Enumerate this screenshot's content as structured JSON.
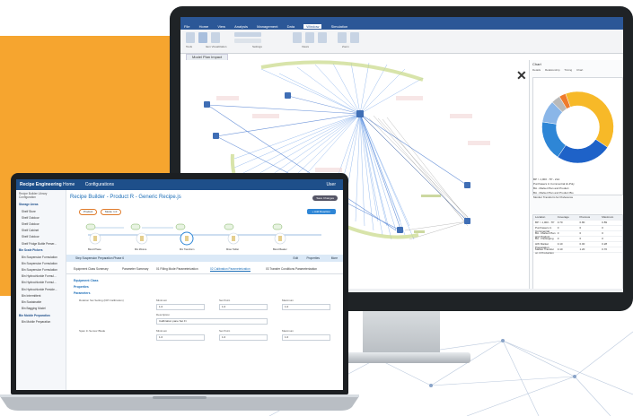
{
  "desktop_app": {
    "ribbon_tabs": [
      "File",
      "Home",
      "View",
      "Analysis",
      "Management",
      "Data",
      "Window",
      "Simulation"
    ],
    "active_tab": "Window",
    "ribbon_labels": [
      "Tools",
      "Item Visualization",
      "Settings",
      "Views",
      "Zoom"
    ],
    "document_tab": "Model Plan Impact",
    "right_panel": {
      "title": "Chart",
      "tabs": [
        "Details",
        "Relationship",
        "Timing",
        "Chart"
      ],
      "legend": [
        "BP > 1,000 - TP - 21A",
        "Purchasers in Commercial Hi-Poly",
        "BA - Market Plan and Product",
        "BA - Market Plan and Product Bio",
        "Monitor Transform for Preference",
        "Pool - Capture Prep"
      ],
      "table_headers": [
        "Location",
        "Coverage",
        "Previous",
        "Maximum"
      ],
      "table_rows": [
        [
          "BP > 1,000 - TP",
          "0.70",
          "0.80",
          "0.89"
        ],
        [
          "Purchasers in Commercial",
          "0",
          "0",
          "0"
        ],
        [
          "BA - Market Plan and Product",
          "0",
          "0",
          "0"
        ],
        [
          "BA - Packaging",
          "0",
          "0",
          "0"
        ],
        [
          "HW Market Preparation",
          "0.10",
          "0.00",
          "0.28"
        ],
        [
          "Market Transfer on it Production",
          "0.10",
          "1.20",
          "0.70"
        ]
      ]
    },
    "donut": [
      {
        "value": 40,
        "color": "#f7b928"
      },
      {
        "value": 25,
        "color": "#1e62c8"
      },
      {
        "value": 18,
        "color": "#2e86d6"
      },
      {
        "value": 10,
        "color": "#8ab6e8"
      },
      {
        "value": 4,
        "color": "#b9b9b9"
      },
      {
        "value": 3,
        "color": "#ef7b2c"
      }
    ]
  },
  "laptop_app": {
    "logo": "Recipe Engineering",
    "nav": [
      "Home",
      "Configurations"
    ],
    "user": "User",
    "sidebar_header": "Recipe Builder Library Configuration",
    "sidebar_groups": [
      {
        "title": "Storage Areas",
        "items": [
          "Shelf Store",
          "Shelf Outdoor",
          "Shelf Outdoor",
          "Shelf Cabinet",
          "Shelf Outdoor",
          "Shelf Fridge Bottle Preser..."
        ]
      },
      {
        "title": "Bin Scale Pickers",
        "items": [
          "Bin Suspension Formulation",
          "Bin Suspension Formulation",
          "Bin Suspension Formulation",
          "Bin Hydrochloride Formul...",
          "Bin Hydrochloride Formul...",
          "Bin Hydrochloride Preside...",
          "Bin Intermittent",
          "Bin Sustainable",
          "Bin Bagging Model"
        ]
      },
      {
        "title": "Bin Mobile Preparation",
        "items": [
          "Bin Mobile Preparation"
        ]
      }
    ],
    "page_title": "Recipe Builder - Product R - Generic Recipe.js",
    "save_label": "Save Changes",
    "pills": [
      "Product",
      "Mode: 1.0"
    ],
    "add_button": "+ Add Reaction",
    "flow_nodes": [
      "Bin Mix",
      "Bin Mix",
      "Bin",
      "Bin",
      "Bin"
    ],
    "flow_labels": [
      "Blend Phase",
      "Mix Mixture",
      "Mix Transform",
      "Mixer Tablet",
      "Blend Beaker"
    ],
    "step_bar": "Step Suspension Preparation Phase 6",
    "step_bar_actions": [
      "Edit",
      "Properties",
      "More"
    ],
    "tabs": [
      "Equipment Class Summary",
      "Parameter Summary",
      "01 Filling Mode Parameterization",
      "02 Calibration Parameterization",
      "03 Transfer Conditions Parameterization"
    ],
    "active_tab_index": 3,
    "sections": [
      "Equipment Class",
      "Properties",
      "Parameters"
    ],
    "form": {
      "row1_label": "Rotation Set Setting (DPI Calibration)",
      "col_headers": [
        "Minimum",
        "Set Point",
        "Maximum"
      ],
      "row1_values": [
        "1.0",
        "1.0",
        "1.0"
      ],
      "description_label": "Description",
      "description_value": "Calibration pane Set Fi",
      "row2_label": "Span In Sensor Blade",
      "row2_values": [
        "1.0",
        "1.0",
        "1.0"
      ]
    }
  }
}
